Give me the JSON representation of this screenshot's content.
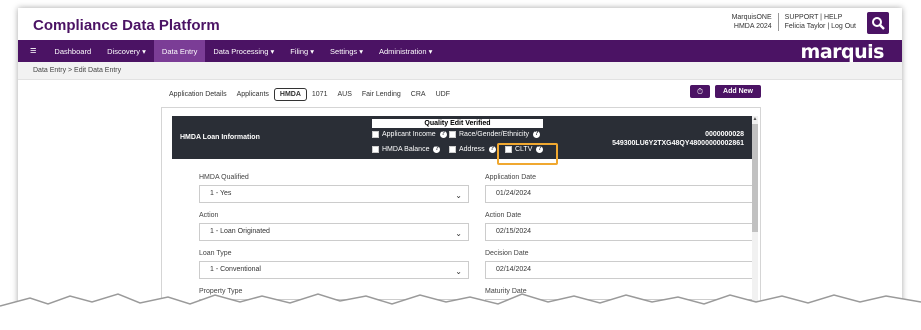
{
  "header": {
    "app_title": "Compliance Data Platform",
    "account_name": "MarquisONE",
    "account_year": "HMDA 2024",
    "support_link": "SUPPORT | HELP",
    "user_line": "Felicia Taylor | Log Out",
    "search_icon": "search-icon"
  },
  "nav": {
    "menu_icon": "≡",
    "items": [
      {
        "label": "Dashboard"
      },
      {
        "label": "Discovery ▾"
      },
      {
        "label": "Data Entry"
      },
      {
        "label": "Data Processing ▾"
      },
      {
        "label": "Filing ▾"
      },
      {
        "label": "Settings ▾"
      },
      {
        "label": "Administration ▾"
      }
    ],
    "brand": "marquis",
    "color": "#4b1364"
  },
  "breadcrumb": "Data Entry  >  Edit Data Entry",
  "tabs": [
    {
      "label": "Application Details"
    },
    {
      "label": "Applicants"
    },
    {
      "label": "HMDA"
    },
    {
      "label": "1071"
    },
    {
      "label": "AUS"
    },
    {
      "label": "Fair Lending"
    },
    {
      "label": "CRA"
    },
    {
      "label": "UDF"
    }
  ],
  "history_icon": "⏱",
  "add_new_label": "Add New",
  "loan_header": {
    "title": "HMDA Loan Information",
    "qev_title": "Quality Edit Verified",
    "checks": {
      "applicant_income": "Applicant Income",
      "race_gender": "Race/Gender/Ethnicity",
      "hmda_balance": "HMDA Balance",
      "address": "Address",
      "cltv": "CLTV"
    },
    "loan_number": "0000000028",
    "uli": "549300LU6Y2TXG48QY48000000002861",
    "highlight_color": "#f0a830"
  },
  "fields": {
    "hmda_qualified": {
      "label": "HMDA Qualified",
      "value": "1 - Yes"
    },
    "application_date": {
      "label": "Application Date",
      "value": "01/24/2024"
    },
    "action": {
      "label": "Action",
      "value": "1 - Loan Originated"
    },
    "action_date": {
      "label": "Action Date",
      "value": "02/15/2024"
    },
    "loan_type": {
      "label": "Loan Type",
      "value": "1 - Conventional"
    },
    "decision_date": {
      "label": "Decision Date",
      "value": "02/14/2024"
    },
    "property_type": {
      "label": "Property Type",
      "value": ""
    },
    "maturity_date": {
      "label": "Maturity Date",
      "placeholder": "Maturity Date"
    }
  }
}
